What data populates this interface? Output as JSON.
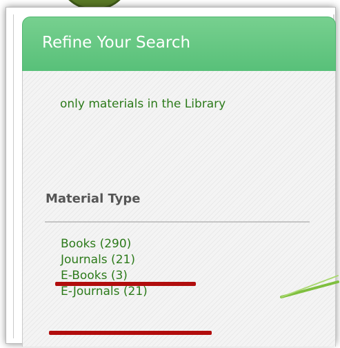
{
  "panel": {
    "title": "Refine Your Search",
    "filter_note": "only materials in the Library",
    "section_title": "Material Type",
    "material_types": [
      {
        "label": "Books (290)"
      },
      {
        "label": "Journals (21)"
      },
      {
        "label": "E-Books (3)"
      },
      {
        "label": "E-Journals (21)"
      }
    ]
  },
  "colors": {
    "header_green": "#5cc27c",
    "link_green": "#2c7a1a",
    "highlight_red": "#b10d0d",
    "arrow_green": "#7fbf3f"
  }
}
